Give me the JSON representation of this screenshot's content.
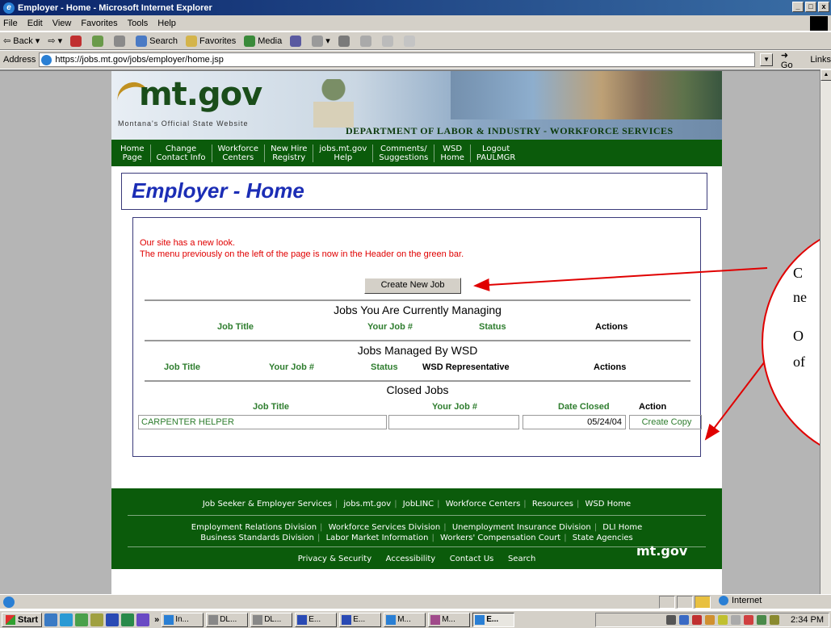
{
  "window": {
    "title": "Employer - Home - Microsoft Internet Explorer",
    "controls": [
      "_",
      "□",
      "x"
    ]
  },
  "menu": [
    "File",
    "Edit",
    "View",
    "Favorites",
    "Tools",
    "Help"
  ],
  "toolbar": {
    "back": "Back",
    "search": "Search",
    "favorites": "Favorites",
    "media": "Media"
  },
  "address": {
    "label": "Address",
    "url": "https://jobs.mt.gov/jobs/employer/home.jsp",
    "go": "Go",
    "links": "Links"
  },
  "banner": {
    "logo_text": "mt.gov",
    "tagline": "Montana's Official State Website",
    "department": "DEPARTMENT OF LABOR & INDUSTRY - WORKFORCE SERVICES DIVISION"
  },
  "nav": [
    {
      "line1": "Home",
      "line2": "Page"
    },
    {
      "line1": "Change",
      "line2": "Contact Info"
    },
    {
      "line1": "Workforce",
      "line2": "Centers"
    },
    {
      "line1": "New Hire",
      "line2": "Registry"
    },
    {
      "line1": "jobs.mt.gov",
      "line2": "Help"
    },
    {
      "line1": "Comments/",
      "line2": "Suggestions"
    },
    {
      "line1": "WSD",
      "line2": "Home"
    },
    {
      "line1": "Logout",
      "line2": "PAULMGR"
    }
  ],
  "page_title": "Employer - Home",
  "notice": {
    "line1": "Our site has a new look.",
    "line2": "The menu previously on the left of the page is now in the Header on the green bar."
  },
  "create_new_job_label": "Create New Job",
  "managing": {
    "heading": "Jobs You Are Currently Managing",
    "columns": [
      "Job Title",
      "Your Job #",
      "Status",
      "Actions"
    ]
  },
  "wsd": {
    "heading": "Jobs Managed By WSD",
    "columns": [
      "Job Title",
      "Your Job #",
      "Status",
      "WSD Representative",
      "Actions"
    ]
  },
  "closed": {
    "heading": "Closed Jobs",
    "columns": [
      "Job Title",
      "Your Job #",
      "Date Closed",
      "Action"
    ],
    "rows": [
      {
        "title": "CARPENTER HELPER",
        "job_no": "",
        "date_closed": "05/24/04",
        "action": "Create Copy"
      }
    ]
  },
  "footer": {
    "row1": [
      "Job Seeker & Employer Services",
      "jobs.mt.gov",
      "JobLINC",
      "Workforce Centers",
      "Resources",
      "WSD Home"
    ],
    "row2": [
      "Employment Relations Division",
      "Workforce Services Division",
      "Unemployment Insurance Division",
      "DLI Home"
    ],
    "row3": [
      "Business Standards Division",
      "Labor Market Information",
      "Workers' Compensation Court",
      "State Agencies"
    ],
    "row4": [
      "Privacy & Security",
      "Accessibility",
      "Contact Us",
      "Search"
    ],
    "logo": "mt.gov"
  },
  "callout": {
    "line1": "C",
    "line2": "ne",
    "line3": "O",
    "line4": "of"
  },
  "status": {
    "zone": "Internet"
  },
  "taskbar": {
    "start": "Start",
    "chevron": "»",
    "tasks": [
      "In...",
      "DL...",
      "DL...",
      "E...",
      "E...",
      "M...",
      "M...",
      "E..."
    ],
    "clock": "2:34 PM"
  }
}
